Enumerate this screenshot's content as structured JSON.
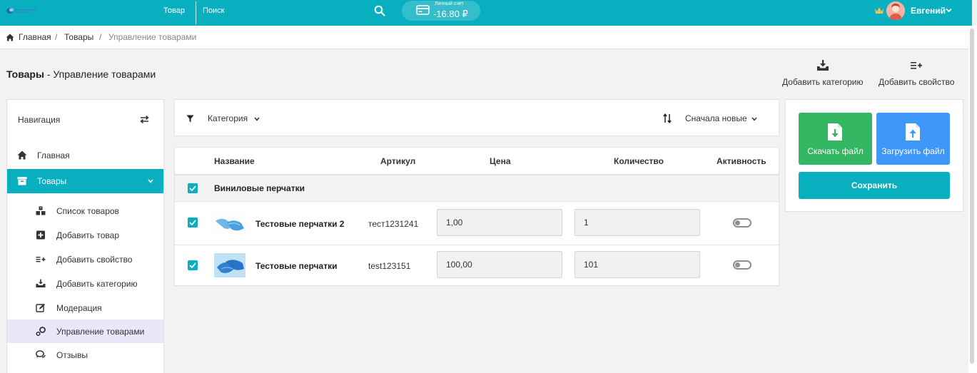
{
  "topbar": {
    "nav_goods": "Товар",
    "nav_search": "Поиск",
    "balance_label": "Личный счет",
    "balance_value": "-16.80 ₽",
    "user_name": "Евгений",
    "icons": [
      "logo",
      "search-icon",
      "card-icon",
      "crown-icon",
      "avatar",
      "chevron-down-icon"
    ],
    "accent_color": "#08afbf"
  },
  "breadcrumb": {
    "items": [
      "Главная",
      "Товары",
      "Управление товарами"
    ],
    "separator": "/"
  },
  "page": {
    "title_strong": "Товары",
    "title_rest": " - Управление товарами"
  },
  "actions": {
    "add_category": "Добавить категорию",
    "add_property": "Добавить свойство"
  },
  "sidebar": {
    "header": "Навигация",
    "main_items": [
      {
        "label": "Главная",
        "icon": "home-icon"
      },
      {
        "label": "Товары",
        "icon": "box-icon",
        "active": true
      }
    ],
    "sub_items": [
      {
        "label": "Список товаров",
        "icon": "boxes-icon"
      },
      {
        "label": "Добавить товар",
        "icon": "plus-square-icon"
      },
      {
        "label": "Добавить свойство",
        "icon": "list-plus-icon"
      },
      {
        "label": "Добавить категорию",
        "icon": "inbox-download-icon"
      },
      {
        "label": "Модерация",
        "icon": "edit-icon"
      },
      {
        "label": "Управление товарами",
        "icon": "gears-icon",
        "selected": true
      },
      {
        "label": "Отзывы",
        "icon": "comments-icon"
      }
    ]
  },
  "filters": {
    "category_label": "Категория",
    "sort_label": "Сначала новые"
  },
  "table": {
    "columns": [
      "Название",
      "Артикул",
      "Цена",
      "Количество",
      "Активность"
    ],
    "group": {
      "label": "Виниловые перчатки",
      "checked": true
    },
    "rows": [
      {
        "name": "Тестовые перчатки 2",
        "sku": "тест1231241",
        "price": "1,00",
        "quantity": "1",
        "checked": true,
        "active": false
      },
      {
        "name": "Тестовые перчатки",
        "sku": "test123151",
        "price": "100,00",
        "quantity": "101",
        "checked": true,
        "active": false
      }
    ]
  },
  "panel": {
    "download_label": "Скачать файл",
    "upload_label": "Загрузить файл",
    "save_label": "Сохранить",
    "download_color": "#34b763",
    "upload_color": "#3d98f9"
  }
}
